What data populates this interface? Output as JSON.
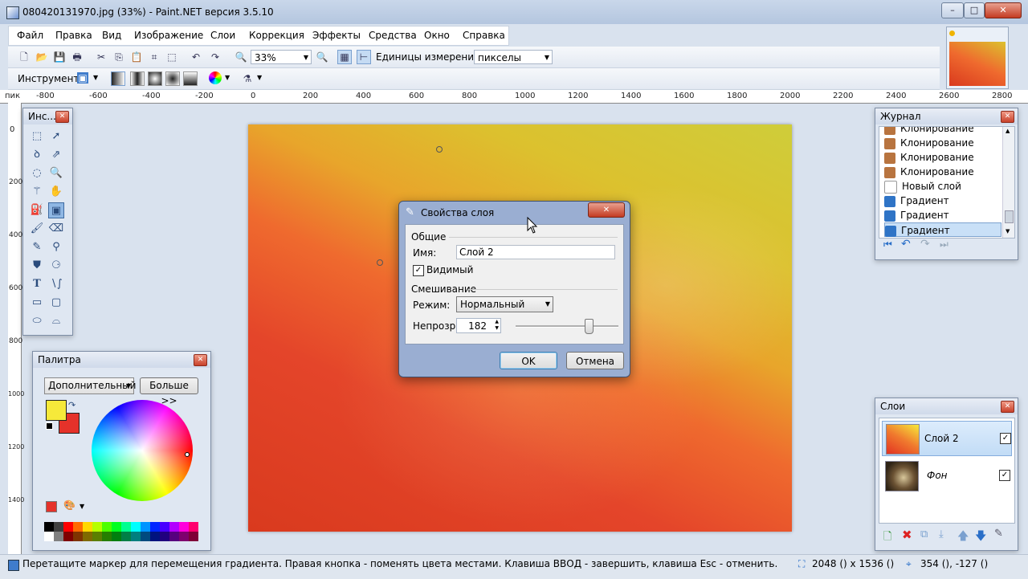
{
  "window": {
    "title": "080420131970.jpg (33%) - Paint.NET версия 3.5.10",
    "min": "–",
    "max": "□",
    "close": "✕"
  },
  "menu": [
    "Файл",
    "Правка",
    "Вид",
    "Изображение",
    "Слои",
    "Коррекция",
    "Эффекты",
    "Средства",
    "Окно",
    "Справка"
  ],
  "toolbar": {
    "zoom_value": "33%",
    "units_label": "Единицы измерения:",
    "units_value": "пикселы",
    "tool_label": "Инструмент:"
  },
  "ruler": {
    "h_unit": "пик",
    "h_ticks": [
      "-800",
      "-600",
      "-400",
      "-200",
      "0",
      "200",
      "400",
      "600",
      "800",
      "1000",
      "1200",
      "1400",
      "1600",
      "1800",
      "2000",
      "2200",
      "2400",
      "2600",
      "2800"
    ],
    "v_ticks": [
      "0",
      "200",
      "400",
      "600",
      "800",
      "1000",
      "1200",
      "1400"
    ]
  },
  "tools_window": {
    "title": "Инс..."
  },
  "palette": {
    "title": "Палитра",
    "mode": "Дополнительный",
    "more": "Больше >>",
    "primary": "#f6e93a",
    "secondary": "#e5322a",
    "swatches_top": [
      "#000000",
      "#404040",
      "#ff0000",
      "#ff6a00",
      "#ffd800",
      "#b6ff00",
      "#4cff00",
      "#00ff21",
      "#00ff90",
      "#00ffff",
      "#0094ff",
      "#0026ff",
      "#4800ff",
      "#b200ff",
      "#ff00dc",
      "#ff006e"
    ],
    "swatches_bottom": [
      "#ffffff",
      "#808080",
      "#7f0000",
      "#7f3300",
      "#7f6a00",
      "#5b7f00",
      "#267f00",
      "#007f0e",
      "#007f46",
      "#007f7f",
      "#004a7f",
      "#00137f",
      "#21007f",
      "#57007f",
      "#7f006e",
      "#7f0037"
    ]
  },
  "history": {
    "title": "Журнал",
    "items": [
      {
        "label": "Клонирование",
        "icon": "stamp-icon"
      },
      {
        "label": "Клонирование",
        "icon": "stamp-icon"
      },
      {
        "label": "Клонирование",
        "icon": "stamp-icon"
      },
      {
        "label": "Клонирование",
        "icon": "stamp-icon"
      },
      {
        "label": "Новый слой",
        "icon": "new-layer-icon"
      },
      {
        "label": "Градиент",
        "icon": "gradient-icon"
      },
      {
        "label": "Градиент",
        "icon": "gradient-icon"
      },
      {
        "label": "Градиент",
        "icon": "gradient-icon"
      }
    ]
  },
  "dialog": {
    "title": "Свойства слоя",
    "general": "Общие",
    "name_label": "Имя:",
    "name_value": "Слой 2",
    "visible_label": "Видимый",
    "blend": "Смешивание",
    "mode_label": "Режим:",
    "mode_value": "Нормальный",
    "opacity_label": "Непрозр.:",
    "opacity_value": "182",
    "opacity_level": 0.71,
    "ok": "OK",
    "cancel": "Отмена"
  },
  "layers": {
    "title": "Слои",
    "items": [
      {
        "label": "Слой 2",
        "checked": true
      },
      {
        "label": "Фон",
        "checked": true
      }
    ]
  },
  "status": {
    "hint": "Перетащите маркер для перемещения градиента. Правая кнопка - поменять цвета местами. Клавиша ВВОД - завершить, клавиша Esc - отменить.",
    "size": "2048 () x 1536 ()",
    "cursor": "354 (), -127 ()"
  }
}
